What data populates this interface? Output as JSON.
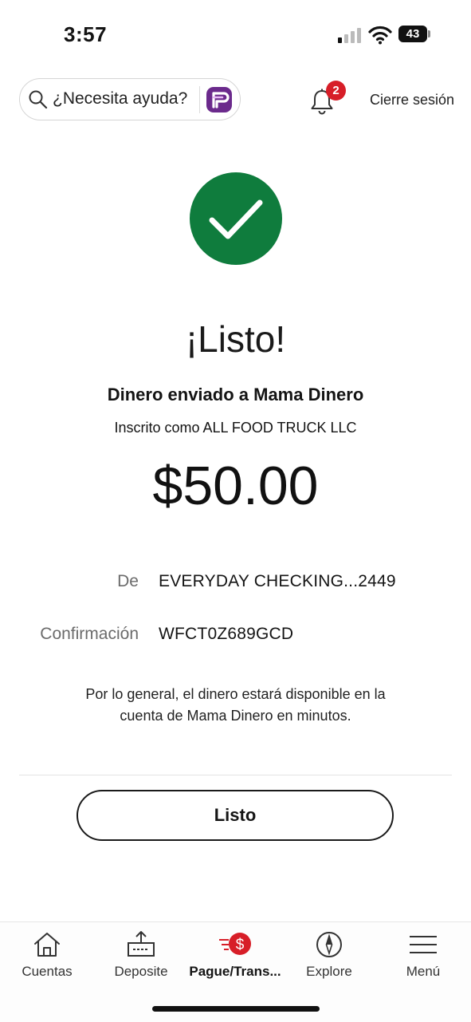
{
  "status_bar": {
    "time": "3:57",
    "battery": "43"
  },
  "header": {
    "search_placeholder": "¿Necesita ayuda?",
    "notifications_count": "2",
    "logout_label": "Cierre sesión"
  },
  "confirmation": {
    "heading": "¡Listo!",
    "recipient_line": "Dinero enviado a Mama Dinero",
    "enrolled_line": "Inscrito como ALL FOOD TRUCK LLC",
    "amount": "$50.00",
    "from_label": "De",
    "from_value": "EVERYDAY CHECKING...2449",
    "confirmation_label": "Confirmación",
    "confirmation_value": "WFCT0Z689GCD",
    "note_line1": "Por lo general, el dinero estará disponible en la",
    "note_line2": "cuenta de Mama Dinero en minutos.",
    "done_button": "Listo"
  },
  "bottom_nav": {
    "items": [
      {
        "label": "Cuentas",
        "icon": "home-icon"
      },
      {
        "label": "Deposite",
        "icon": "deposit-icon"
      },
      {
        "label": "Pague/Trans...",
        "icon": "pay-transfer-icon",
        "active": true
      },
      {
        "label": "Explore",
        "icon": "compass-icon"
      },
      {
        "label": "Menú",
        "icon": "menu-icon"
      }
    ]
  },
  "colors": {
    "success_green": "#0f7c3d",
    "alert_red": "#d71e28",
    "fargo_purple": "#6b2a8c"
  }
}
